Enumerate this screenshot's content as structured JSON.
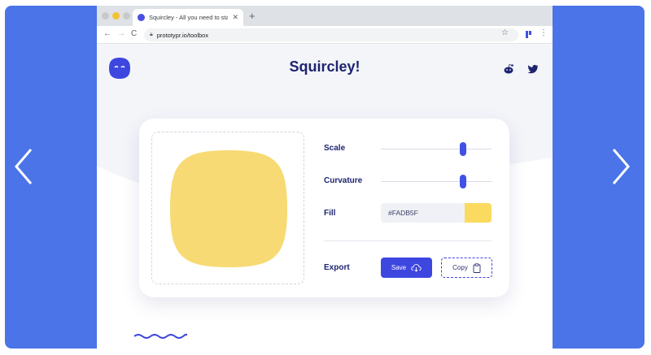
{
  "browser": {
    "tab_title": "Squircley - All you need to start u",
    "tab_close": "✕",
    "new_tab": "+",
    "url": "prototypr.io/toolbox",
    "nav_back": "←",
    "nav_forward": "→",
    "nav_reload": "C"
  },
  "site": {
    "title": "Squircley!"
  },
  "controls": {
    "scale_label": "Scale",
    "scale_value": 0.74,
    "curvature_label": "Curvature",
    "curvature_value": 0.74,
    "fill_label": "Fill",
    "fill_value": "#FADB5F",
    "export_label": "Export",
    "save_label": "Save",
    "copy_label": "Copy"
  },
  "colors": {
    "page_frame": "#4a74e8",
    "accent": "#3d47e0",
    "title": "#1e2470",
    "squircle_fill": "#FADB5F"
  },
  "icons": {
    "logo": "squircle-face-logo",
    "reddit": "reddit-icon",
    "twitter": "twitter-icon",
    "save": "cloud-download-icon",
    "copy": "clipboard-icon",
    "carousel_prev": "chevron-left-icon",
    "carousel_next": "chevron-right-icon"
  }
}
